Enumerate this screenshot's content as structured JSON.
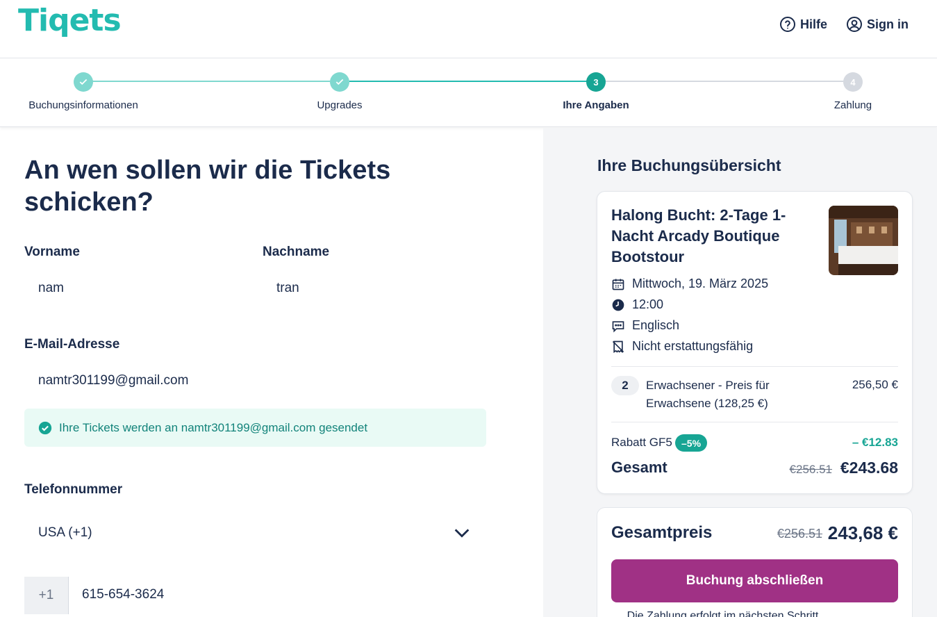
{
  "header": {
    "logo": "Tiqets",
    "help_label": "Hilfe",
    "signin_label": "Sign in",
    "accent_color": "#23bbb0"
  },
  "stepper": {
    "steps": [
      {
        "label": "Buchungsinformationen",
        "number": "",
        "state": "completed"
      },
      {
        "label": "Upgrades",
        "number": "",
        "state": "completed"
      },
      {
        "label": "Ihre Angaben",
        "number": "3",
        "state": "active"
      },
      {
        "label": "Zahlung",
        "number": "4",
        "state": "upcoming"
      }
    ]
  },
  "form": {
    "title": "An wen sollen wir die Tickets schicken?",
    "first_name_label": "Vorname",
    "first_name_value": "nam",
    "last_name_label": "Nachname",
    "last_name_value": "tran",
    "email_label": "E-Mail-Adresse",
    "email_value": "namtr301199@gmail.com",
    "email_notice": "Ihre Tickets werden an namtr301199@gmail.com gesendet",
    "phone_label": "Telefonnummer",
    "country_value": "USA (+1)",
    "phone_prefix": "+1",
    "phone_value": "615-654-3624"
  },
  "summary": {
    "title": "Ihre Buchungsübersicht",
    "product_title": "Halong Bucht: 2-Tage 1-Nacht Arcady Boutique Bootstour",
    "date": "Mittwoch, 19. März 2025",
    "time": "12:00",
    "language": "Englisch",
    "refund_policy": "Nicht erstattungsfähig",
    "ticket_qty": "2",
    "ticket_desc": "Erwachsener - Preis für Erwachsene (128,25 €)",
    "ticket_price": "256,50 €",
    "discount_label": "Rabatt GF5",
    "discount_badge": "–5%",
    "discount_amount": "– €12.83",
    "total_label": "Gesamt",
    "total_old": "€256.51",
    "total_new": "€243.68"
  },
  "checkout": {
    "price_label": "Gesamtpreis",
    "price_old": "€256.51",
    "price_new": "243,68 €",
    "submit_label": "Buchung abschließen",
    "payment_note": "Die Zahlung erfolgt im nächsten Schritt",
    "button_color": "#a03185"
  }
}
